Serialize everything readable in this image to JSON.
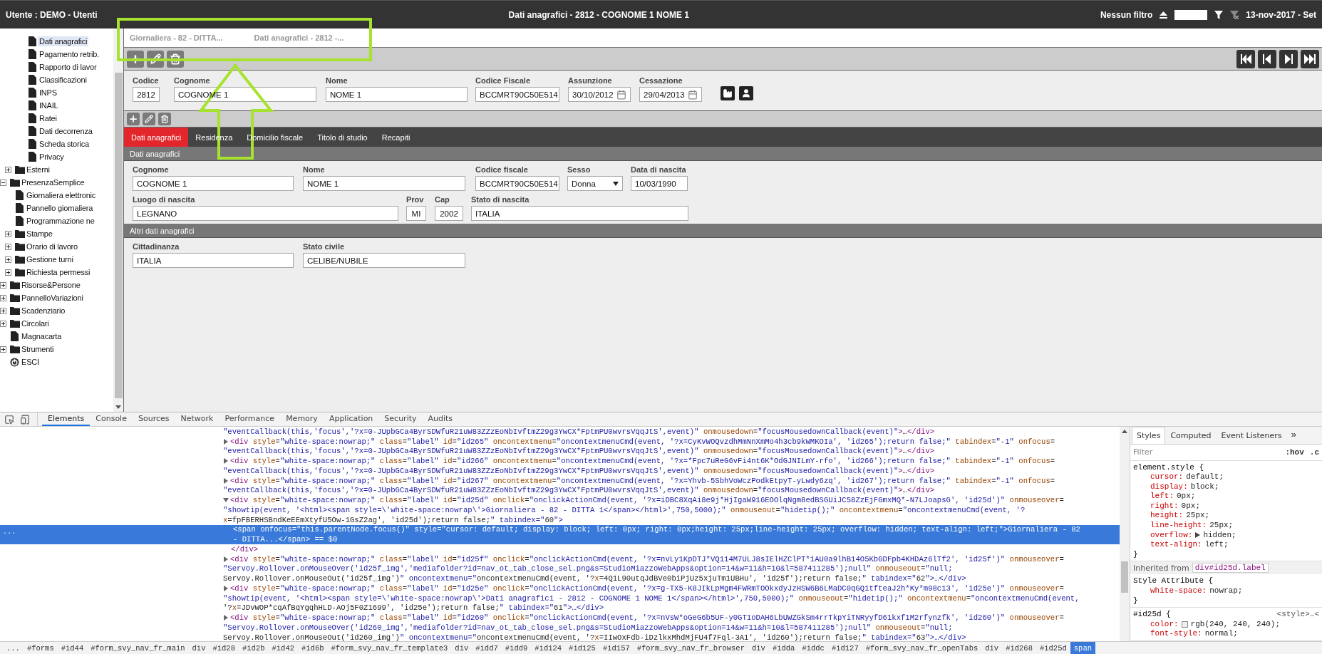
{
  "top_bar": {
    "user": "Utente : DEMO - Utenti",
    "title": "Dati anagrafici - 2812 - COGNOME 1 NOME 1",
    "filter": "Nessun filtro",
    "date": "13-nov-2017 - Set"
  },
  "tree": [
    {
      "children": [
        {
          "children": [
            {
              "label": "Dati anagrafici",
              "kind": "document",
              "selected": true
            },
            {
              "label": "Pagamento retrib.",
              "kind": "document",
              "selected": false
            },
            {
              "label": "Rapporto di lavor",
              "kind": "document",
              "selected": false
            },
            {
              "label": "Classificazioni",
              "kind": "document",
              "selected": false
            },
            {
              "label": "INPS",
              "kind": "document",
              "selected": false
            },
            {
              "label": "INAIL",
              "kind": "document",
              "selected": false
            },
            {
              "label": "Ratei",
              "kind": "document",
              "selected": false
            },
            {
              "label": "Dati decorrenza",
              "kind": "document",
              "selected": false
            },
            {
              "label": "Scheda storica",
              "kind": "document",
              "selected": false
            },
            {
              "label": "Privacy",
              "kind": "document",
              "selected": false
            }
          ]
        },
        {
          "label": "Esterni",
          "kind": "folder",
          "expanded": false,
          "selected": false
        }
      ]
    },
    {
      "label": "PresenzaSemplice",
      "kind": "folder",
      "expanded": true,
      "selected": false,
      "children": [
        {
          "label": "Giornaliera elettronic",
          "kind": "document",
          "selected": false
        },
        {
          "label": "Pannello giornaliera",
          "kind": "document",
          "selected": false
        },
        {
          "label": "Programmazione ne",
          "kind": "document",
          "selected": false
        },
        {
          "label": "Stampe",
          "kind": "folder",
          "expanded": false,
          "selected": false
        },
        {
          "label": "Orario di lavoro",
          "kind": "folder",
          "expanded": false,
          "selected": false
        },
        {
          "label": "Gestione turni",
          "kind": "folder",
          "expanded": false,
          "selected": false
        },
        {
          "label": "Richiesta permessi",
          "kind": "folder",
          "expanded": false,
          "selected": false
        }
      ]
    },
    {
      "label": "Risorse&Persone",
      "kind": "folder",
      "expanded": false,
      "selected": false
    },
    {
      "label": "PannelloVariazioni",
      "kind": "folder",
      "expanded": false,
      "selected": false
    },
    {
      "label": "Scadenziario",
      "kind": "folder",
      "expanded": false,
      "selected": false
    },
    {
      "label": "Circolari",
      "kind": "folder",
      "expanded": false,
      "selected": false
    },
    {
      "label": "Magnacarta",
      "kind": "document",
      "selected": false
    },
    {
      "label": "Strumenti",
      "kind": "folder",
      "expanded": false,
      "selected": false
    },
    {
      "label": "ESCI",
      "kind": "exit",
      "selected": false
    }
  ],
  "open_tabs": [
    {
      "label": "Giornaliera - 82 - DITTA..."
    },
    {
      "label": "Dati anagrafici - 2812 -..."
    }
  ],
  "header_form": {
    "fields": [
      {
        "label": "Codice",
        "value": "2812",
        "kind": "text"
      },
      {
        "label": "Cognome",
        "value": "COGNOME 1",
        "kind": "text"
      },
      {
        "label": "Nome",
        "value": "NOME 1",
        "kind": "text"
      },
      {
        "label": "Codice Fiscale",
        "value": "BCCMRT90C50E514",
        "kind": "text"
      },
      {
        "label": "Assunzione",
        "value": "30/10/2012",
        "kind": "date"
      },
      {
        "label": "Cessazione",
        "value": "29/04/2013",
        "kind": "date"
      }
    ]
  },
  "detail_tabs": [
    {
      "label": "Dati anagrafici",
      "selected": true
    },
    {
      "label": "Residenza",
      "selected": false
    },
    {
      "label": "Domicilio fiscale",
      "selected": false
    },
    {
      "label": "Titolo di studio",
      "selected": false
    },
    {
      "label": "Recapiti",
      "selected": false
    }
  ],
  "sections": [
    {
      "title": "Dati anagrafici",
      "fields": [
        {
          "label": "Cognome",
          "value": "COGNOME 1",
          "kind": "text"
        },
        {
          "label": "Nome",
          "value": "NOME 1",
          "kind": "text"
        },
        {
          "label": "Codice fiscale",
          "value": "BCCMRT90C50E514",
          "kind": "text"
        },
        {
          "label": "Sesso",
          "value": "Donna",
          "kind": "select"
        },
        {
          "label": "Data di nascita",
          "value": "10/03/1990",
          "kind": "text"
        },
        {
          "label": "Luogo di nascita",
          "value": "LEGNANO",
          "kind": "text"
        },
        {
          "label": "Prov",
          "value": "MI",
          "kind": "text"
        },
        {
          "label": "Cap",
          "value": "2002",
          "kind": "text"
        },
        {
          "label": "Stato di nascita",
          "value": "ITALIA",
          "kind": "text"
        }
      ]
    },
    {
      "title": "Altri dati anagrafici",
      "fields": [
        {
          "label": "Cittadinanza",
          "value": "ITALIA",
          "kind": "text"
        },
        {
          "label": "Stato civile",
          "value": "CELIBE/NUBILE",
          "kind": "text"
        }
      ]
    }
  ],
  "devtools": {
    "tabs": [
      {
        "label": "Elements",
        "selected": true
      },
      {
        "label": "Console",
        "selected": false
      },
      {
        "label": "Sources",
        "selected": false
      },
      {
        "label": "Network",
        "selected": false
      },
      {
        "label": "Performance",
        "selected": false
      },
      {
        "label": "Memory",
        "selected": false
      },
      {
        "label": "Application",
        "selected": false
      },
      {
        "label": "Security",
        "selected": false
      },
      {
        "label": "Audits",
        "selected": false
      }
    ],
    "dom_tree": [
      {
        "expandable": false,
        "selected": false,
        "lines": [
          "\"eventCallback(this,'focus','?x=0-JUpbGCa4ByrSDWfuR21uW83ZZzEoNbIvftmZ29g3YwCX*FptmPU0wvrsVqqJtS',event)\" onmousedown=\"focusMousedownCallback(event)\">…</div>"
        ]
      },
      {
        "expandable": true,
        "expanded": false,
        "selected": false,
        "lines": [
          "<div style=\"white-space:nowrap;\" class=\"label\" id=\"id265\" oncontextmenu=\"oncontextmenuCmd(event, '?x=CyKvWOQvzdhMmNnXmMo4h3cb9kWMKOIa', 'id265');return false;\" tabindex=\"-1\" onfocus=",
          "\"eventCallback(this,'focus','?x=0-JUpbGCa4ByrSDWfuR21uW83ZZzEoNbIvftmZ29g3YwCX*FptmPU0wvrsVqqJtS',event)\" onmousedown=\"focusMousedownCallback(event)\">…</div>"
        ]
      },
      {
        "expandable": true,
        "expanded": false,
        "selected": false,
        "lines": [
          "<div style=\"white-space:nowrap;\" class=\"label\" id=\"id266\" oncontextmenu=\"oncontextmenuCmd(event, '?x=*Fpc7uReG6vFi4nt6K*OdGJNILmY-rfo', 'id266');return false;\" tabindex=\"-1\" onfocus=",
          "\"eventCallback(this,'focus','?x=0-JUpbGCa4ByrSDWfuR21uW83ZZzEoNbIvftmZ29g3YwCX*FptmPU0wvrsVqqJtS',event)\" onmousedown=\"focusMousedownCallback(event)\">…</div>"
        ]
      },
      {
        "expandable": true,
        "expanded": false,
        "selected": false,
        "lines": [
          "<div style=\"white-space:nowrap;\" class=\"label\" id=\"id267\" oncontextmenu=\"oncontextmenuCmd(event, '?x=Yhvb-5SbhVoWczPodkEtpyT-yLwdy6zq', 'id267');return false;\" tabindex=\"-1\" onfocus=",
          "\"eventCallback(this,'focus','?x=0-JUpbGCa4ByrSDWfuR21uW83ZZzEoNbIvftmZ29g3YwCX*FptmPU0wvrsVqqJtS',event)\" onmousedown=\"focusMousedownCallback(event)\">…</div>"
        ]
      },
      {
        "expandable": true,
        "expanded": true,
        "selected": false,
        "lines": [
          "<div style=\"white-space:nowrap;\" class=\"label\" id=\"id25d\" onclick=\"onclickActionCmd(event, '?x=iDBC8XqAi8e9j*HjIgaW916EOOlqNgm8edBSGUiJC58ZzEjFGmxMQ*-N7LJoapsG', 'id25d')\" onmouseover=",
          "\"showtip(event, '<html><span style=\\'white-space:nowrap\\'>Giornaliera - 82 - DITTA 1</span></html>',750,5000);\" onmouseout=\"hidetip();\" oncontextmenu=\"oncontextmenuCmd(event, '?",
          "x=fpFBERHSBndKeEEmXtyfU5Ow-1GsZ2ag', 'id25d');return false;\" tabindex=\"60\">"
        ],
        "children": [
          {
            "expandable": false,
            "selected": true,
            "marker": "...",
            "lines": [
              "<span onfocus=\"this.parentNode.focus()\" style=\"cursor: default; display: block; left: 0px; right: 0px;height: 25px;line-height: 25px; overflow: hidden; text-align: left;\">Giornaliera - 82",
              "- DITTA...</span> == $0"
            ]
          }
        ],
        "closing": "</div>"
      },
      {
        "expandable": true,
        "expanded": false,
        "selected": false,
        "lines": [
          "<div style=\"white-space:nowrap;\" class=\"label\" id=\"id25f\" onclick=\"onclickActionCmd(event, '?x=nvLy1KpDTJ*VQ114M7ULJ8sIElHZClPT*1AU0a9lhB14O5KbGDFpb4KHDAz6lTf2', 'id25f')\" onmouseover=",
          "\"Servoy.Rollover.onMouseOver('id25f_img','mediafolder?id=nav_ot_tab_close_sel.png&s=StudioMiazzoWebApps&option=14&w=11&h=10&l=587411285');null\" onmouseout=\"null;",
          "Servoy.Rollover.onMouseOut('id25f_img')\" oncontextmenu=\"oncontextmenuCmd(event, '?x=4Q1L90utqJdBVe0biPjUz5xjuTm1UBHu', 'id25f');return false;\" tabindex=\"62\">…</div>"
        ]
      },
      {
        "expandable": true,
        "expanded": false,
        "selected": false,
        "lines": [
          "<div style=\"white-space:nowrap;\" class=\"label\" id=\"id25e\" onclick=\"onclickActionCmd(event, '?x=g-TX5-K8JIkLpMgm4FWRmTOOkxdyJzHSW6B6LMaDC0qGQ1tfteaJ2h*Ky*m98c13', 'id25e')\" onmouseover=",
          "\"showtip(event, '<html><span style=\\'white-space:nowrap\\'>Dati anagrafici - 2812 - COGNOME 1 NOME 1</span></html>',750,5000);\" onmouseout=\"hidetip();\" oncontextmenu=\"oncontextmenuCmd(event,",
          "'?x=JDvWOP*cqAfBqYgqhHLD-AOj5F0Z1699', 'id25e');return false;\" tabindex=\"61\">…</div>"
        ]
      },
      {
        "expandable": true,
        "expanded": false,
        "selected": false,
        "lines": [
          "<div style=\"white-space:nowrap;\" class=\"label\" id=\"id260\" onclick=\"onclickActionCmd(event, '?x=nVsW*oGeG6b5UF-y0GT1oDAH6LbUWZGkSm4rrTkpYiTNRyyfD61kxf1M2rfynzfk', 'id260')\" onmouseover=",
          "\"Servoy.Rollover.onMouseOver('id260_img','mediafolder?id=nav_ot_tab_close_sel.png&s=StudioMiazzoWebApps&option=14&w=11&h=10&l=587411285');null\" onmouseout=\"null;",
          "Servoy.Rollover.onMouseOut('id260_img')\" oncontextmenu=\"oncontextmenuCmd(event, '?x=IIwOxFdb-iDzlkxMhdMjFU4f7Fql-3A1', 'id260');return false;\" tabindex=\"63\">…</div>"
        ]
      }
    ],
    "styles_panel": {
      "tabs": [
        {
          "label": "Styles",
          "selected": true
        },
        {
          "label": "Computed",
          "selected": false
        },
        {
          "label": "Event Listeners",
          "selected": false
        }
      ],
      "more": "»",
      "filter_placeholder": "Filter",
      "hov": ":hov",
      "cls": ".c",
      "rules": [
        {
          "selector": "element.style {",
          "declarations": [
            {
              "property": "cursor:",
              "value": "default;"
            },
            {
              "property": "display:",
              "value": "block;"
            },
            {
              "property": "left:",
              "value": "0px;"
            },
            {
              "property": "right:",
              "value": "0px;"
            },
            {
              "property": "height:",
              "value": "25px;"
            },
            {
              "property": "line-height:",
              "value": "25px;"
            },
            {
              "property": "overflow:",
              "value": "hidden;",
              "expandable": true
            },
            {
              "property": "text-align:",
              "value": "left;"
            }
          ],
          "close": "}"
        },
        {
          "inherited_label": "Inherited from",
          "inherited_element": "div#id25d.label"
        },
        {
          "selector": "Style Attribute {",
          "declarations": [
            {
              "property": "white-space:",
              "value": "nowrap;"
            }
          ],
          "close": "}"
        },
        {
          "selector": "#id25d {",
          "source": "<style>…<",
          "declarations": [
            {
              "property": "color:",
              "value": "rgb(240, 240, 240);",
              "color": "#f0f0f0"
            },
            {
              "property": "font-style:",
              "value": "normal;"
            }
          ]
        }
      ]
    },
    "breadcrumbs": [
      {
        "label": "...",
        "selected": false
      },
      {
        "label": "#forms",
        "selected": false
      },
      {
        "label": "#id44",
        "selected": false
      },
      {
        "label": "#form_svy_nav_fr_main",
        "selected": false
      },
      {
        "label": "div",
        "selected": false
      },
      {
        "label": "#id28",
        "selected": false
      },
      {
        "label": "#id2b",
        "selected": false
      },
      {
        "label": "#id42",
        "selected": false
      },
      {
        "label": "#id6b",
        "selected": false
      },
      {
        "label": "#form_svy_nav_fr_template3",
        "selected": false
      },
      {
        "label": "div",
        "selected": false
      },
      {
        "label": "#idd7",
        "selected": false
      },
      {
        "label": "#idd9",
        "selected": false
      },
      {
        "label": "#id124",
        "selected": false
      },
      {
        "label": "#id125",
        "selected": false
      },
      {
        "label": "#id157",
        "selected": false
      },
      {
        "label": "#form_svy_nav_fr_browser",
        "selected": false
      },
      {
        "label": "div",
        "selected": false
      },
      {
        "label": "#idda",
        "selected": false
      },
      {
        "label": "#iddc",
        "selected": false
      },
      {
        "label": "#id127",
        "selected": false
      },
      {
        "label": "#form_svy_nav_fr_openTabs",
        "selected": false
      },
      {
        "label": "div",
        "selected": false
      },
      {
        "label": "#id268",
        "selected": false
      },
      {
        "label": "#id25d",
        "selected": false
      },
      {
        "label": "span",
        "selected": true
      }
    ]
  }
}
